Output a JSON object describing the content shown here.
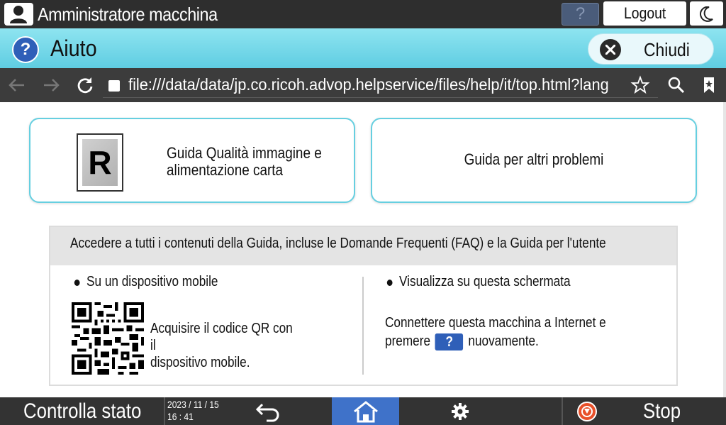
{
  "topbar": {
    "user_name": "Amministratore macchina",
    "help_label": "?",
    "logout_label": "Logout"
  },
  "titlebar": {
    "help_icon_label": "?",
    "title": "Aiuto",
    "close_label": "Chiudi"
  },
  "browser": {
    "url": "file:///data/data/jp.co.ricoh.advop.helpservice/files/help/it/top.html?lang=it&"
  },
  "content": {
    "card_left": {
      "icon_letter": "R",
      "line1": "Guida Qualità immagine e",
      "line2": "alimentazione carta"
    },
    "card_right": {
      "label": "Guida per altri problemi"
    },
    "access": {
      "header": "Accedere a tutti i contenuti della Guida, incluse le Domande Frequenti (FAQ) e la Guida per l'utente",
      "mobile": {
        "title": "Su un dispositivo mobile",
        "line1": "Acquisire il codice QR con il",
        "line2": "dispositivo mobile."
      },
      "screen": {
        "title": "Visualizza su questa schermata",
        "line1": "Connettere questa macchina a Internet e",
        "line2_pre": "premere",
        "button_label": "?",
        "line2_post": "nuovamente."
      }
    }
  },
  "bottombar": {
    "status_label": "Controlla stato",
    "date": "2023 / 11 / 15",
    "time": "16 : 41",
    "stop_label": "Stop"
  },
  "colors": {
    "accent_cyan": "#5fcde2",
    "brand_blue": "#2f5fb8",
    "home_blue": "#3f72c9",
    "stop_orange": "#e8502a"
  }
}
